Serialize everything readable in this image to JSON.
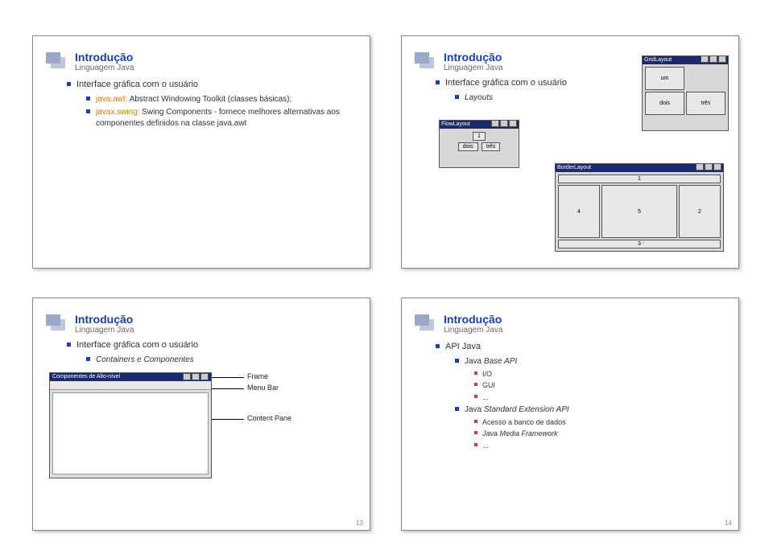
{
  "slides": {
    "tl": {
      "title": "Introdução",
      "subtitle": "Linguagem Java",
      "item1": "Interface gráfica com o usuário",
      "item1a_rich_prefix": "java.awt:",
      "item1a_rest": " Abstract Windowing Toolkit (classes básicas);",
      "item1b_rich_prefix": "javax.swing:",
      "item1b_rest": " Swing Components - fornece melhores alternativas aos componentes definidos na classe java.awt"
    },
    "tr": {
      "title": "Introdução",
      "subtitle": "Linguagem Java",
      "item1": "Interface gráfica com o usuário",
      "item1a": "Layouts",
      "flow_title": "FlowLayout",
      "flow_b1": "1",
      "flow_b2": "dois",
      "flow_b3": "três",
      "grid_title": "GridLayout",
      "grid_b1": "um",
      "grid_b2": "dois",
      "grid_b3": "três",
      "border_title": "BorderLayout",
      "border_n": "1",
      "border_w": "4",
      "border_c": "5",
      "border_e": "2",
      "border_s": "3"
    },
    "bl": {
      "title": "Introdução",
      "subtitle": "Linguagem Java",
      "item1": "Interface gráfica com o usuário",
      "item1a": "Containers e Componentes",
      "mock_title": "Componentes de Alto-nível",
      "label_frame": "Frame",
      "label_menubar": "Menu Bar",
      "label_contentpane": "Content Pane",
      "pagenum": "13"
    },
    "br": {
      "title": "Introdução",
      "subtitle": "Linguagem Java",
      "item1": "API Java",
      "item1a": "Java Base API",
      "i1a1": "I/O",
      "i1a2": "GUI",
      "i1a3": "...",
      "item1b": "Java Standard Extension API",
      "i1b1": "Acesso a banco de dados",
      "i1b2": "Java Media Framework",
      "i1b3": "...",
      "pagenum": "14"
    }
  }
}
